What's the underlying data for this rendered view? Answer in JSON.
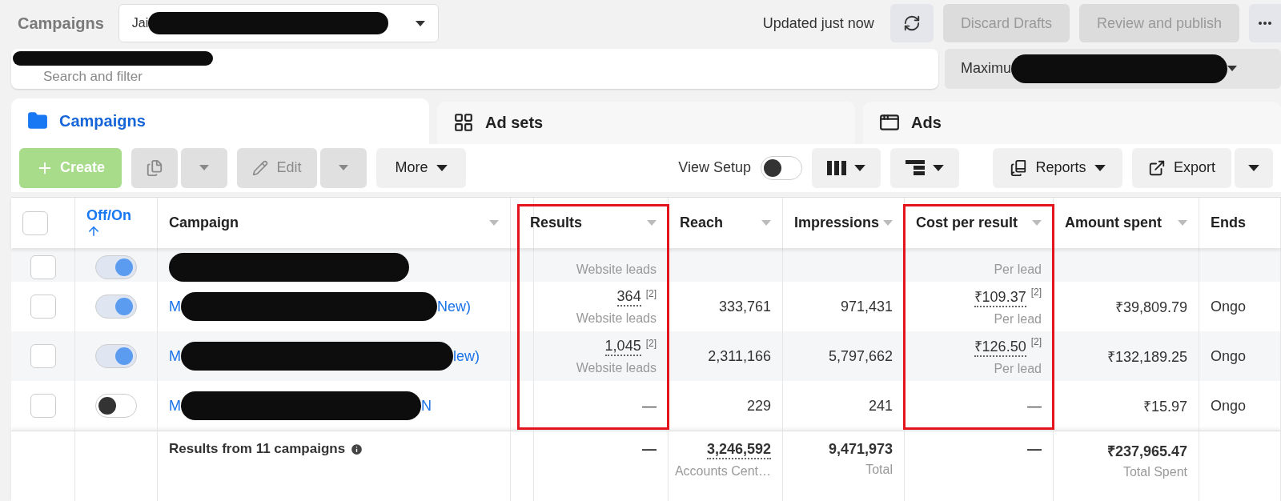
{
  "header": {
    "title": "Campaigns",
    "account": {
      "visible_text": "Jai"
    },
    "status": "Updated just now",
    "buttons": [
      {
        "label": "Discard Drafts",
        "disabled": true
      },
      {
        "label": "Review and publish",
        "disabled": true
      }
    ]
  },
  "search": {
    "placeholder": "Search and filter"
  },
  "date_selector": {
    "visible_text": "Maximu"
  },
  "tabs": [
    {
      "label": "Campaigns",
      "selected": true
    },
    {
      "label": "Ad sets",
      "selected": false
    },
    {
      "label": "Ads",
      "selected": false
    }
  ],
  "toolbar": {
    "create": {
      "label": "Create",
      "disabled": true
    },
    "duplicate": {
      "disabled": true
    },
    "edit": {
      "label": "Edit",
      "disabled": true
    },
    "more": "More",
    "view_setup": {
      "label": "View Setup",
      "on": false
    },
    "reports": "Reports",
    "export": "Export"
  },
  "table": {
    "select_all": {
      "checked": false
    },
    "columns": [
      {
        "label": "Off/On",
        "sorted": true,
        "menu": false,
        "highlighted": false
      },
      {
        "label": "Campaign",
        "sorted": false,
        "menu": true,
        "highlighted": false
      },
      {
        "label": "Results",
        "sorted": false,
        "menu": true,
        "highlighted": true
      },
      {
        "label": "Reach",
        "sorted": false,
        "menu": true,
        "highlighted": false
      },
      {
        "label": "Impressions",
        "sorted": false,
        "menu": true,
        "highlighted": false
      },
      {
        "label": "Cost per result",
        "sorted": false,
        "menu": true,
        "highlighted": true
      },
      {
        "label": "Amount spent",
        "sorted": false,
        "menu": true,
        "highlighted": false
      },
      {
        "label": "Ends",
        "sorted": false,
        "menu": false,
        "highlighted": false
      }
    ],
    "rows": [
      {
        "checked": false,
        "on": true,
        "results": {
          "unit": "Website leads"
        },
        "cost": {
          "unit": "Per lead"
        }
      },
      {
        "checked": false,
        "on": true,
        "name_start": "M",
        "name_end": "New)",
        "results": {
          "value": "364",
          "note": "[2]",
          "unit": "Website leads"
        },
        "reach": "333,761",
        "impressions": "971,431",
        "cost": {
          "value": "₹109.37",
          "note": "[2]",
          "unit": "Per lead"
        },
        "amount": "₹39,809.79",
        "ends": "Ongo"
      },
      {
        "checked": false,
        "on": true,
        "name_start": "M",
        "name_end": "lew)",
        "results": {
          "value": "1,045",
          "note": "[2]",
          "unit": "Website leads"
        },
        "reach": "2,311,166",
        "impressions": "5,797,662",
        "cost": {
          "value": "₹126.50",
          "note": "[2]",
          "unit": "Per lead"
        },
        "amount": "₹132,189.25",
        "ends": "Ongo"
      },
      {
        "checked": false,
        "on": false,
        "name_start": "M",
        "name_end": "N",
        "results": {
          "value": "—"
        },
        "reach": "229",
        "impressions": "241",
        "cost": {
          "value": "—"
        },
        "amount": "₹15.97",
        "ends": "Ongo"
      }
    ],
    "footer": {
      "label": "Results from 11 campaigns",
      "results": "—",
      "reach": {
        "value": "3,246,592",
        "unit": "Accounts Cent…"
      },
      "impressions": {
        "value": "9,471,973",
        "unit": "Total"
      },
      "cost": "—",
      "amount": {
        "value": "₹237,965.47",
        "unit": "Total Spent"
      }
    }
  }
}
